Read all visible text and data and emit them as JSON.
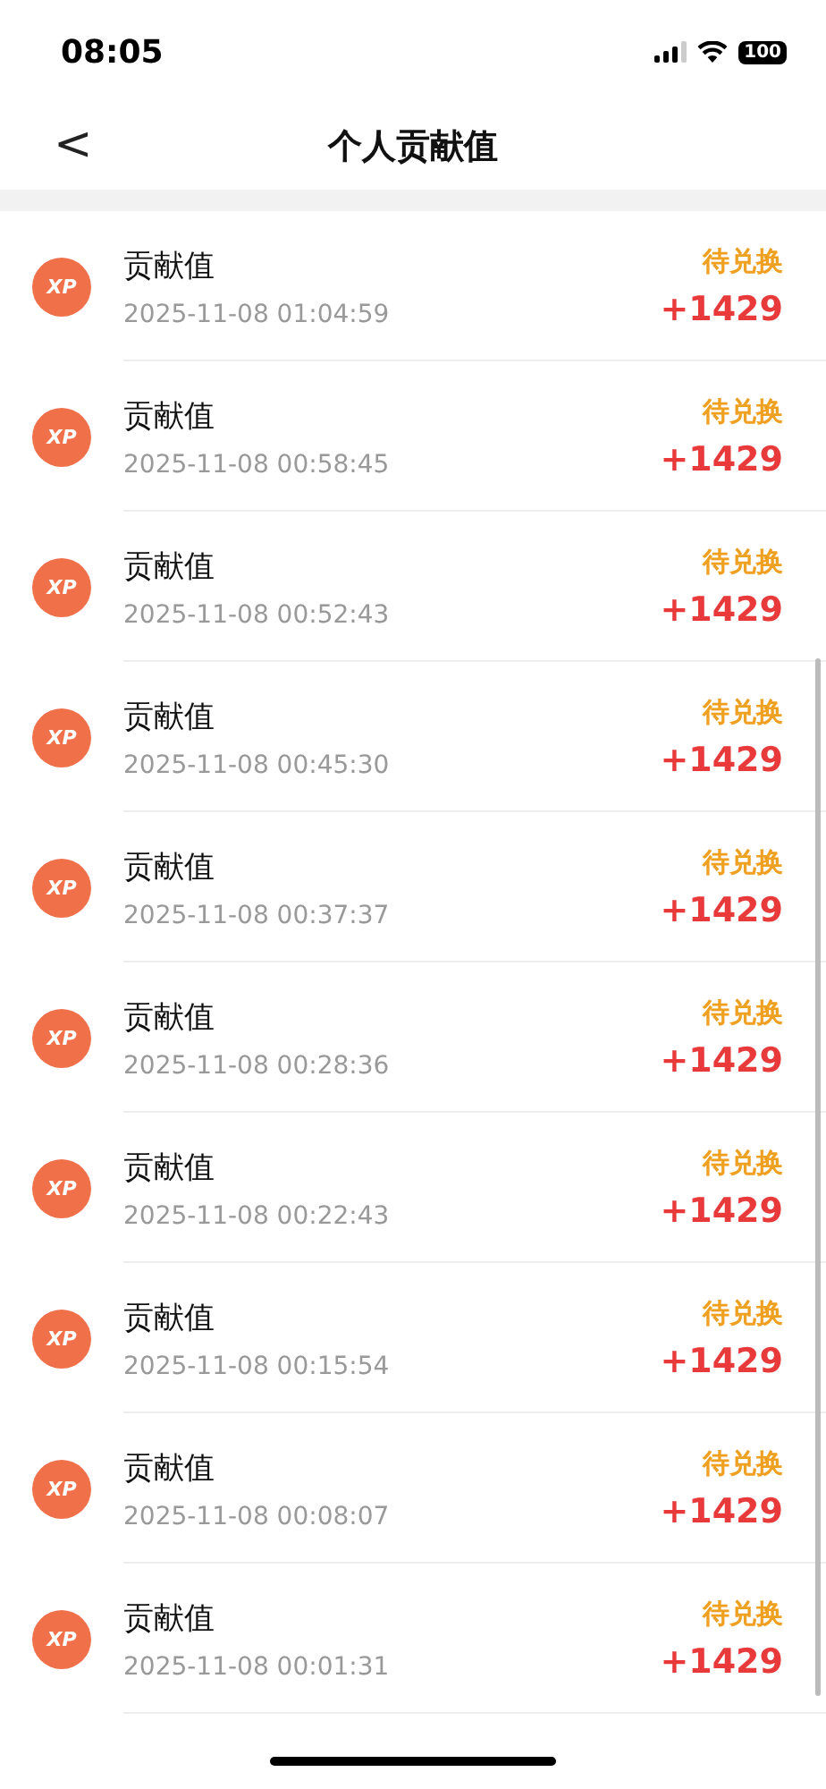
{
  "status_bar": {
    "time": "08:05",
    "battery": "100"
  },
  "nav": {
    "back": "<",
    "title": "个人贡献值"
  },
  "records": [
    {
      "badge": "XP",
      "title": "贡献值",
      "time": "2025-11-08 01:04:59",
      "status": "待兑换",
      "amount": "+1429"
    },
    {
      "badge": "XP",
      "title": "贡献值",
      "time": "2025-11-08 00:58:45",
      "status": "待兑换",
      "amount": "+1429"
    },
    {
      "badge": "XP",
      "title": "贡献值",
      "time": "2025-11-08 00:52:43",
      "status": "待兑换",
      "amount": "+1429"
    },
    {
      "badge": "XP",
      "title": "贡献值",
      "time": "2025-11-08 00:45:30",
      "status": "待兑换",
      "amount": "+1429"
    },
    {
      "badge": "XP",
      "title": "贡献值",
      "time": "2025-11-08 00:37:37",
      "status": "待兑换",
      "amount": "+1429"
    },
    {
      "badge": "XP",
      "title": "贡献值",
      "time": "2025-11-08 00:28:36",
      "status": "待兑换",
      "amount": "+1429"
    },
    {
      "badge": "XP",
      "title": "贡献值",
      "time": "2025-11-08 00:22:43",
      "status": "待兑换",
      "amount": "+1429"
    },
    {
      "badge": "XP",
      "title": "贡献值",
      "time": "2025-11-08 00:15:54",
      "status": "待兑换",
      "amount": "+1429"
    },
    {
      "badge": "XP",
      "title": "贡献值",
      "time": "2025-11-08 00:08:07",
      "status": "待兑换",
      "amount": "+1429"
    },
    {
      "badge": "XP",
      "title": "贡献值",
      "time": "2025-11-08 00:01:31",
      "status": "待兑换",
      "amount": "+1429"
    }
  ]
}
